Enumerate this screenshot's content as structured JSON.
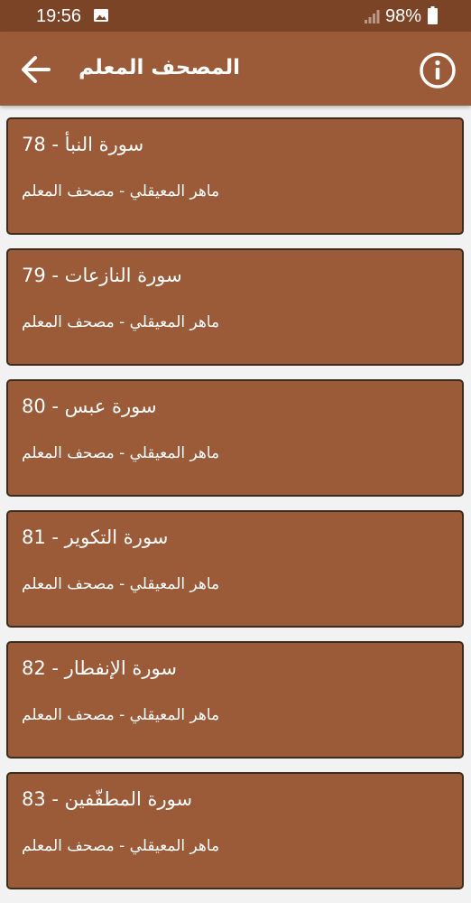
{
  "status_bar": {
    "time": "19:56",
    "battery": "98%",
    "icons": [
      "image-icon",
      "signal-icon",
      "battery-icon"
    ]
  },
  "app_bar": {
    "title": "المصحف المعلم",
    "back_icon": "arrow-left-icon",
    "info_icon": "info-icon"
  },
  "surahs": [
    {
      "number": "78",
      "name": "سورة النبأ",
      "subtitle": "ماهر المعيقلي - مصحف المعلم"
    },
    {
      "number": "79",
      "name": "سورة النازعات",
      "subtitle": "ماهر المعيقلي - مصحف المعلم"
    },
    {
      "number": "80",
      "name": "سورة عبس",
      "subtitle": "ماهر المعيقلي - مصحف المعلم"
    },
    {
      "number": "81",
      "name": "سورة التكوير",
      "subtitle": "ماهر المعيقلي - مصحف المعلم"
    },
    {
      "number": "82",
      "name": "سورة الإنفطار",
      "subtitle": "ماهر المعيقلي - مصحف المعلم"
    },
    {
      "number": "83",
      "name": "سورة المطفّفين",
      "subtitle": "ماهر المعيقلي - مصحف المعلم"
    }
  ],
  "colors": {
    "status_bar": "#7b4426",
    "app_bar": "#9b5a38",
    "card": "#9b5a38",
    "card_border": "#3c2c1e",
    "background": "#f2f2f2",
    "text": "#ffffff"
  }
}
